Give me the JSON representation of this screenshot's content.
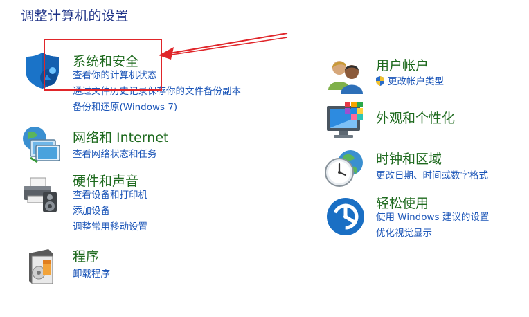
{
  "page": {
    "title": "调整计算机的设置"
  },
  "colors": {
    "title": "#1e3287",
    "category": "#1e6a1e",
    "link": "#1c56b8",
    "annotation": "#e0262a"
  },
  "categories": [
    {
      "title": "系统和安全",
      "icon": "shield-icon",
      "links": [
        "查看你的计算机状态",
        "通过文件历史记录保存你的文件备份副本",
        "备份和还原(Windows 7)"
      ]
    },
    {
      "title": "网络和 Internet",
      "icon": "network-icon",
      "links": [
        "查看网络状态和任务"
      ]
    },
    {
      "title": "硬件和声音",
      "icon": "printer-speaker-icon",
      "links": [
        "查看设备和打印机",
        "添加设备",
        "调整常用移动设置"
      ]
    },
    {
      "title": "程序",
      "icon": "programs-icon",
      "links": [
        "卸载程序"
      ]
    },
    {
      "title": "用户帐户",
      "icon": "users-icon",
      "links": [
        "更改帐户类型"
      ]
    },
    {
      "title": "外观和个性化",
      "icon": "monitor-palette-icon",
      "links": []
    },
    {
      "title": "时钟和区域",
      "icon": "clock-globe-icon",
      "links": [
        "更改日期、时间或数字格式"
      ]
    },
    {
      "title": "轻松使用",
      "icon": "ease-of-access-icon",
      "links": [
        "使用 Windows 建议的设置",
        "优化视觉显示"
      ]
    }
  ]
}
